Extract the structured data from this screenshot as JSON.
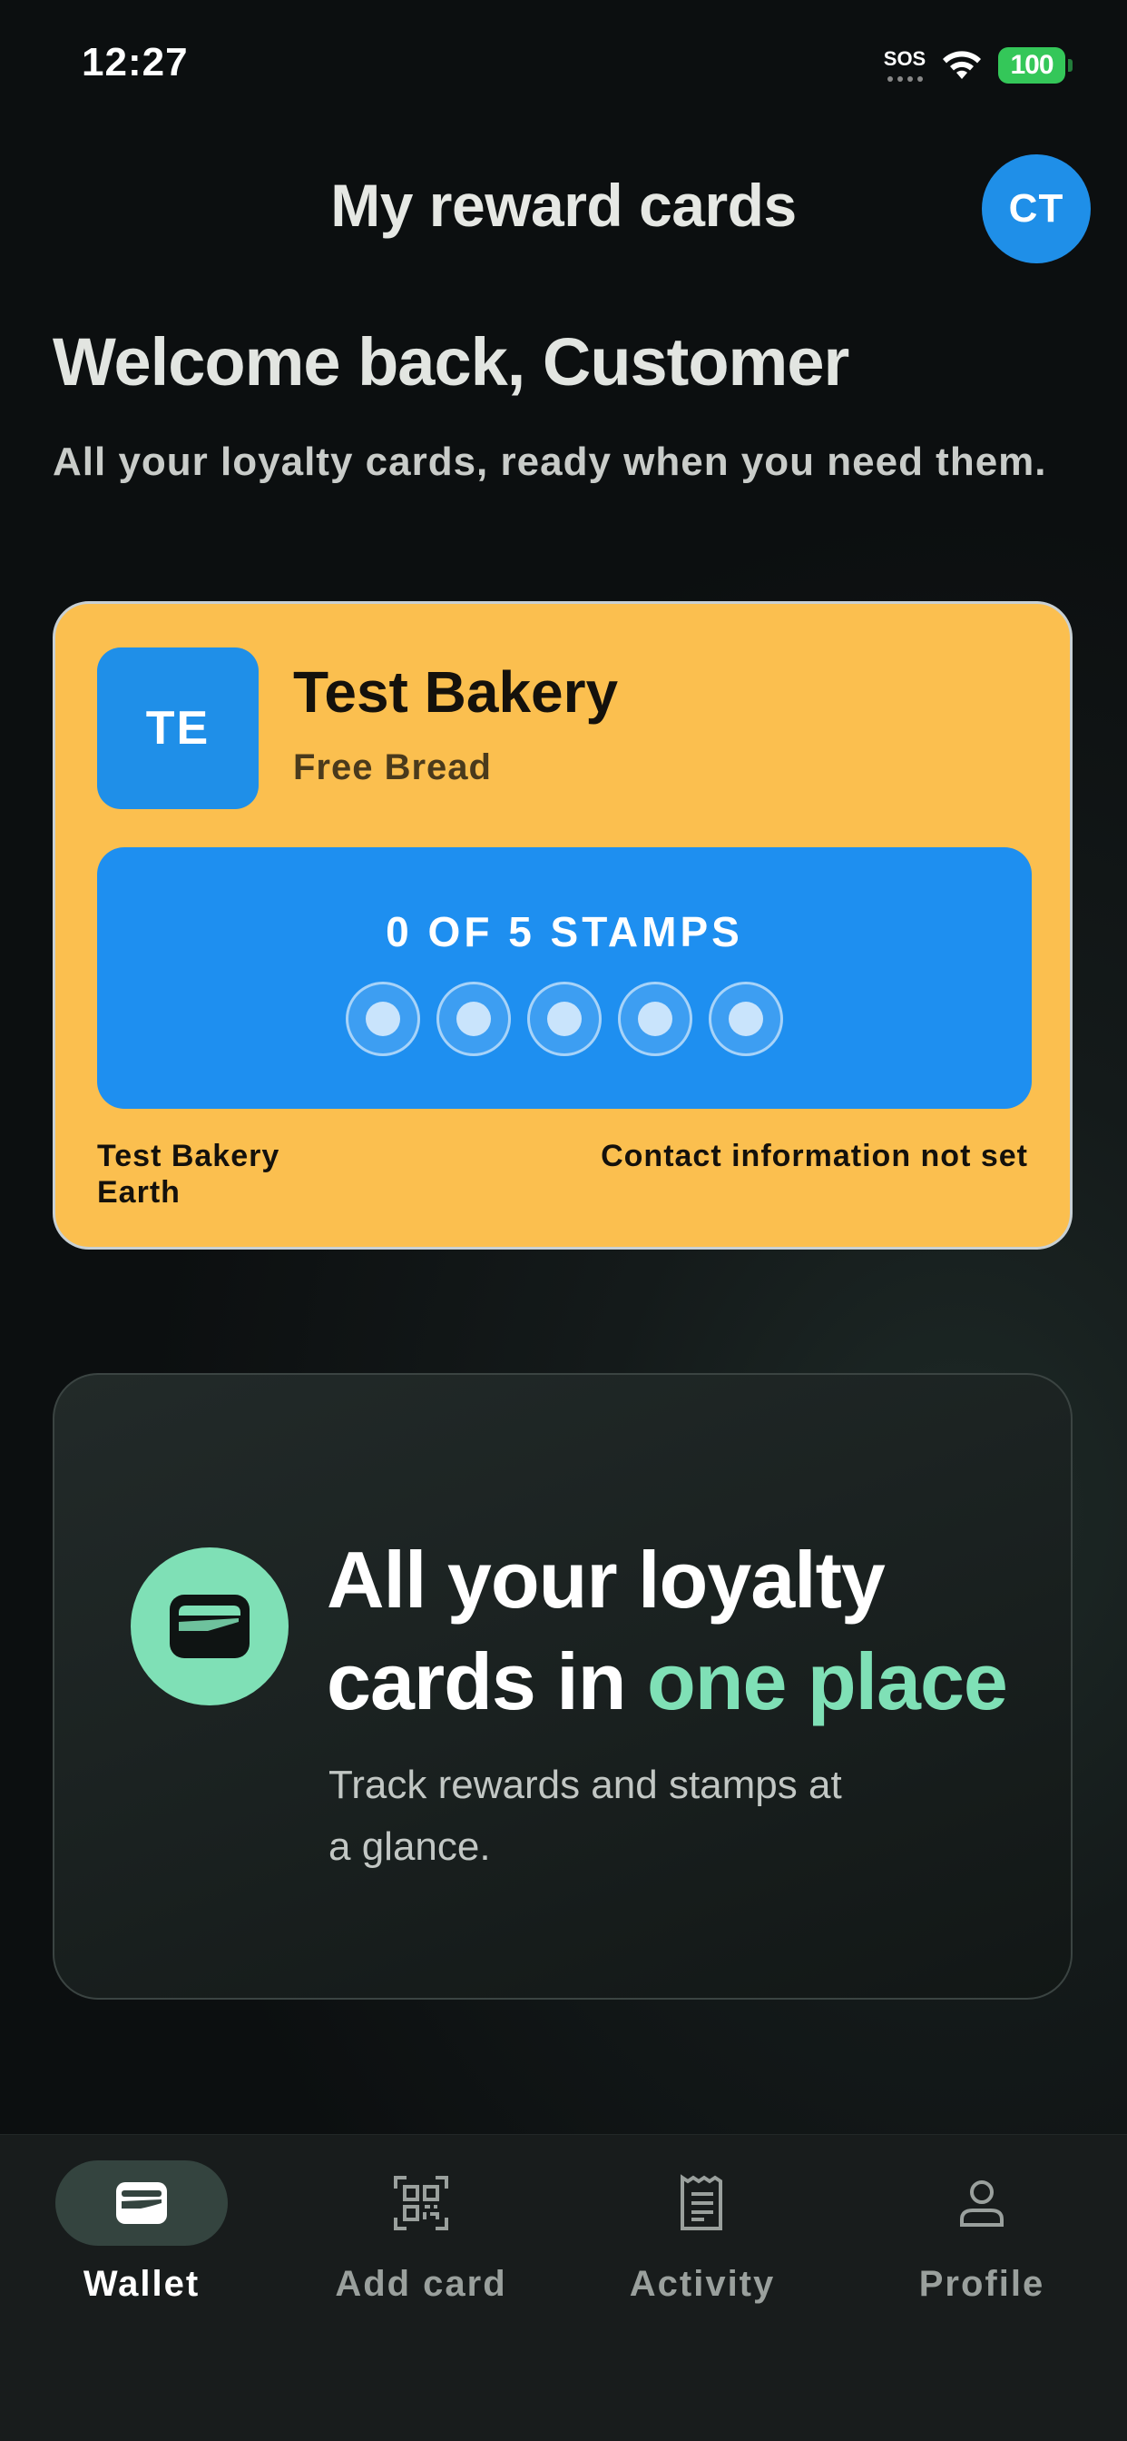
{
  "status_bar": {
    "time": "12:27",
    "sos": "SOS",
    "battery": "100"
  },
  "header": {
    "title": "My reward cards",
    "avatar_initials": "CT"
  },
  "welcome": {
    "title": "Welcome back, Customer",
    "subtitle": "All your loyalty cards, ready when you need them."
  },
  "card": {
    "badge": "TE",
    "merchant": "Test Bakery",
    "reward": "Free Bread",
    "stamps_label": "0 OF 5 STAMPS",
    "stamps_collected": 0,
    "stamps_total": 5,
    "location_line1": "Test Bakery",
    "location_line2": "Earth",
    "contact": "Contact information not set",
    "color": "#fbbf4f",
    "accent": "#1e8ff0"
  },
  "promo": {
    "title_part1": "All your loyalty cards in ",
    "title_highlight": "one place",
    "subtitle": "Track rewards and stamps at a glance.",
    "icon": "wallet-icon",
    "accent": "#7fe0b6"
  },
  "nav": {
    "items": [
      {
        "label": "Wallet",
        "icon": "wallet-icon",
        "active": true
      },
      {
        "label": "Add card",
        "icon": "qr-code-icon",
        "active": false
      },
      {
        "label": "Activity",
        "icon": "receipt-icon",
        "active": false
      },
      {
        "label": "Profile",
        "icon": "person-icon",
        "active": false
      }
    ]
  }
}
